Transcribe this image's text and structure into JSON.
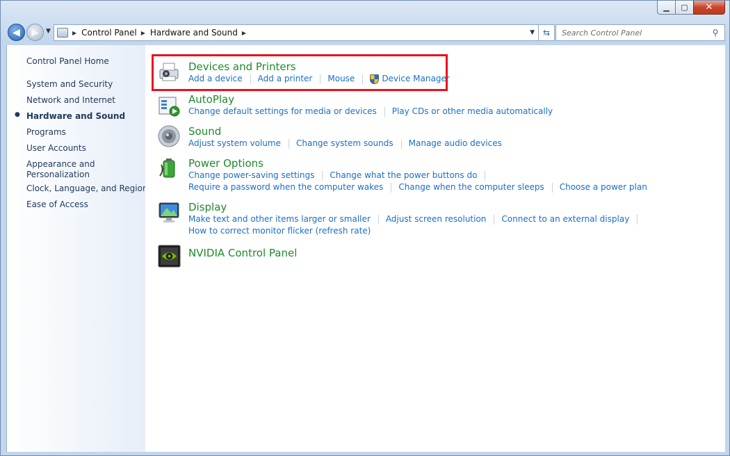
{
  "window": {
    "caption_buttons": {
      "minimize": "▁",
      "maximize": "▢",
      "close": "✕"
    }
  },
  "nav": {
    "back_icon": "◀",
    "forward_icon": "▶",
    "breadcrumbs": [
      "Control Panel",
      "Hardware and Sound"
    ],
    "search_placeholder": "Search Control Panel"
  },
  "sidebar": {
    "items": [
      {
        "label": "Control Panel Home",
        "current": false
      },
      {
        "label": "System and Security",
        "current": false
      },
      {
        "label": "Network and Internet",
        "current": false
      },
      {
        "label": "Hardware and Sound",
        "current": true
      },
      {
        "label": "Programs",
        "current": false
      },
      {
        "label": "User Accounts",
        "current": false
      },
      {
        "label": "Appearance and",
        "label2": "Personalization",
        "current": false
      },
      {
        "label": "Clock, Language, and Region",
        "current": false
      },
      {
        "label": "Ease of Access",
        "current": false
      }
    ]
  },
  "sections": [
    {
      "title": "Devices and Printers",
      "icon": "printer-icon",
      "rows": [
        [
          "Add a device",
          "Add a printer",
          "Mouse",
          "Device Manager"
        ]
      ]
    },
    {
      "title": "AutoPlay",
      "icon": "autoplay-icon",
      "rows": [
        [
          "Change default settings for media or devices",
          "Play CDs or other media automatically"
        ]
      ]
    },
    {
      "title": "Sound",
      "icon": "speaker-icon",
      "rows": [
        [
          "Adjust system volume",
          "Change system sounds",
          "Manage audio devices"
        ]
      ]
    },
    {
      "title": "Power Options",
      "icon": "battery-icon",
      "rows": [
        [
          "Change power-saving settings",
          "Change what the power buttons do"
        ],
        [
          "Require a password when the computer wakes",
          "Change when the computer sleeps",
          "Choose a power plan"
        ]
      ]
    },
    {
      "title": "Display",
      "icon": "monitor-icon",
      "rows": [
        [
          "Make text and other items larger or smaller",
          "Adjust screen resolution",
          "Connect to an external display"
        ],
        [
          "How to correct monitor flicker (refresh rate)"
        ]
      ]
    },
    {
      "title": "NVIDIA Control Panel",
      "icon": "nvidia-icon",
      "rows": []
    }
  ],
  "colors": {
    "highlight": "#e8101d",
    "title_link": "#1e8a2a",
    "task_link": "#1a6dc8"
  }
}
